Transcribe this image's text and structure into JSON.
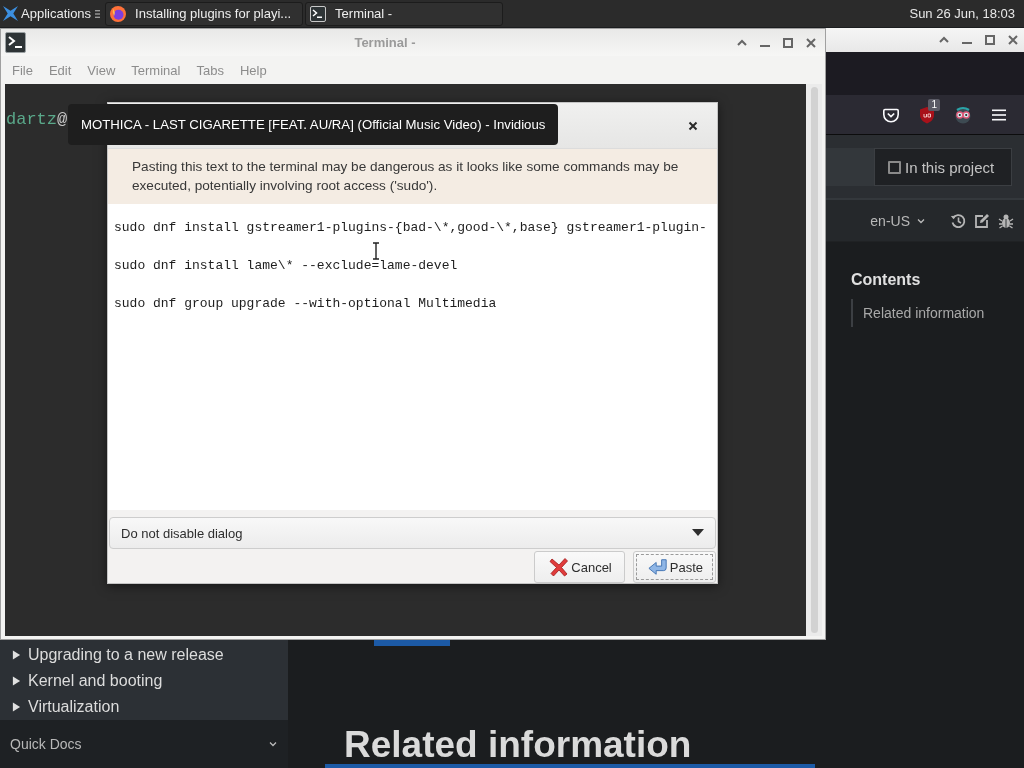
{
  "top_panel": {
    "menu_label": "Applications",
    "tasks": [
      {
        "kind": "browser",
        "label": "Installing plugins for playi..."
      },
      {
        "kind": "terminal",
        "label": "Terminal -"
      }
    ],
    "clock": "Sun 26 Jun, 18:03"
  },
  "browser": {
    "badge": "1",
    "search_scope": {
      "label": "In this project",
      "checked": false
    },
    "language": "en-US",
    "sidebar": {
      "items": [
        {
          "label": "Upgrading to a new release",
          "expanded": false
        },
        {
          "label": "Kernel and booting",
          "expanded": false
        },
        {
          "label": "Virtualization",
          "expanded": false
        }
      ],
      "footer": "Quick Docs"
    },
    "heading": "Related information",
    "toc": {
      "title": "Contents",
      "items": [
        "Related information"
      ]
    }
  },
  "terminal": {
    "title": "Terminal -",
    "menu": [
      "File",
      "Edit",
      "View",
      "Terminal",
      "Tabs",
      "Help"
    ],
    "prompt": {
      "user": "dartz",
      "symbol": "@"
    }
  },
  "dialog": {
    "warning": "Pasting this text to the terminal may be dangerous as it looks like some commands may be executed, potentially involving root access ('sudo').",
    "commands": [
      "sudo dnf install gstreamer1-plugins-{bad-\\*,good-\\*,base} gstreamer1-plugin-",
      "sudo dnf install lame\\* --exclude=lame-devel",
      "sudo dnf group upgrade --with-optional Multimedia"
    ],
    "option": "Do not disable dialog",
    "buttons": [
      {
        "kind": "cancel",
        "label": "Cancel",
        "focused": false
      },
      {
        "kind": "paste",
        "label": "Paste",
        "focused": true
      }
    ]
  },
  "tooltip": "MOTHICA - LAST CIGARETTE [FEAT. AU/RA] (Official Music Video) - Invidious"
}
